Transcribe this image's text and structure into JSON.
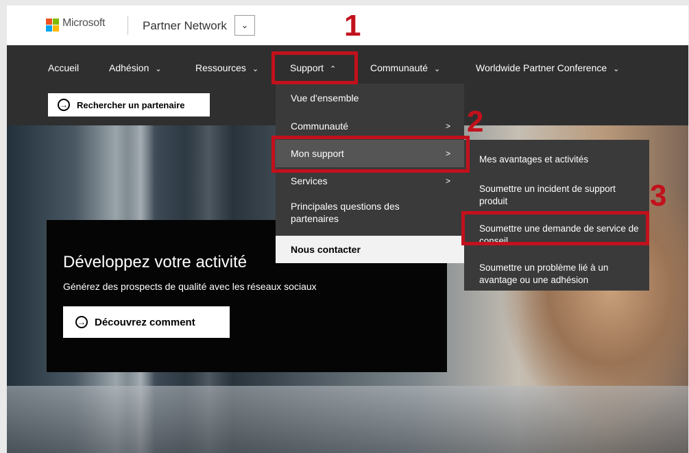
{
  "header": {
    "brand": "Microsoft",
    "site": "Partner Network",
    "site_dropdown_icon": "chevron-down-icon",
    "logo_colors": [
      "#f25022",
      "#7fba00",
      "#00a4ef",
      "#ffb900"
    ]
  },
  "nav": {
    "items": [
      {
        "label": "Accueil",
        "chevron": ""
      },
      {
        "label": "Adhésion",
        "chevron": "⌄"
      },
      {
        "label": "Ressources",
        "chevron": "⌄"
      },
      {
        "label": "Support",
        "chevron": "⌃"
      },
      {
        "label": "Communauté",
        "chevron": "⌄"
      },
      {
        "label": "Worldwide Partner Conference",
        "chevron": "⌄"
      }
    ],
    "search_button": "Rechercher un partenaire"
  },
  "support_menu": {
    "items": [
      {
        "label": "Vue d'ensemble",
        "arrow": ""
      },
      {
        "label": "Communauté",
        "arrow": ">"
      },
      {
        "label": "Mon support",
        "arrow": ">"
      },
      {
        "label": "Services",
        "arrow": ">"
      },
      {
        "label": "Principales questions des partenaires",
        "arrow": ""
      },
      {
        "label": "Nous contacter",
        "arrow": ""
      }
    ]
  },
  "mon_support_menu": {
    "items": [
      {
        "label": "Mes avantages et activités"
      },
      {
        "label": "Soumettre un incident de support produit"
      },
      {
        "label": "Soumettre une demande de service de conseil"
      },
      {
        "label": "Soumettre un problème lié à un avantage ou une adhésion"
      }
    ]
  },
  "hero": {
    "title": "Développez votre activité",
    "subtitle": "Générez des prospects de qualité avec les réseaux sociaux",
    "cta": "Découvrez comment"
  },
  "annotations": {
    "step1": "1",
    "step2": "2",
    "step3": "3",
    "color": "#c2111c"
  }
}
